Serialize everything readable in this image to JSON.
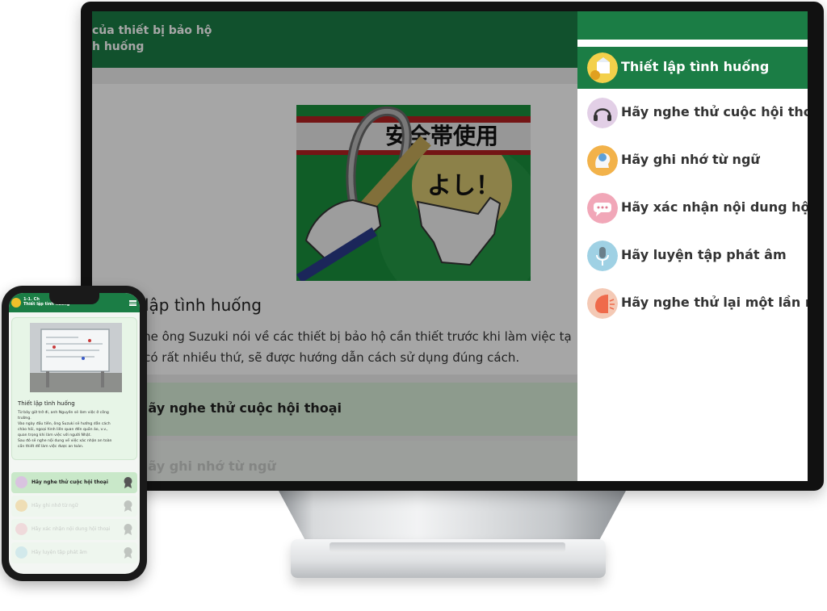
{
  "monitor": {
    "page": {
      "header_line1": "của thiết bị bảo hộ",
      "header_line2": "h huống",
      "scenario_title": "Thiết lập tình huống",
      "scenario_line1": "n sẽ nghe ông Suzuki nói về các thiết bị bảo hộ cần thiết trước khi làm việc tạ",
      "scenario_line2": "bảo hộ có rất nhiều thứ, sẽ được hướng dẫn cách sử dụng đúng cách.",
      "step1_label": "Hãy nghe thử cuộc hội thoại",
      "step2_label": "Hãy ghi nhớ từ ngữ",
      "hero_sign_top": "安全帯使用",
      "hero_sign_bottom": "よし！"
    },
    "menu": {
      "items": [
        {
          "label": "Thiết lập tình huống",
          "icon": "scenario-icon",
          "active": true
        },
        {
          "label": "Hãy nghe thử cuộc hội thoại",
          "icon": "headphones-icon"
        },
        {
          "label": "Hãy ghi nhớ từ ngữ",
          "icon": "memory-icon"
        },
        {
          "label": "Hãy xác nhận nội dung hội th",
          "icon": "chat-bubble-icon"
        },
        {
          "label": "Hãy luyện tập phát âm",
          "icon": "microphone-icon"
        },
        {
          "label": "Hãy nghe thử lại một lần nữa",
          "icon": "listen-again-icon"
        }
      ]
    }
  },
  "phone": {
    "header_line1": "1-1. Ch",
    "header_line2": "Thiết lập tình huống",
    "card_title": "Thiết lập tình huống",
    "card_lines": [
      "Từ bây giờ trở đi, anh Nguyên sẽ làm việc ở công",
      "trường.",
      "Vào ngày đầu tiên, ông Suzuki sẽ hướng dẫn cách",
      "chào hỏi, ngoại hình liên quan đến quần áo, v.v.,",
      " quan trọng khi làm việc với người Nhật.",
      "Sau đó sẽ nghe nội dung về việc xác nhận an toàn",
      "cần thiết để làm việc được an toàn."
    ],
    "items": [
      {
        "label": "Hãy nghe thử cuộc hội thoại"
      },
      {
        "label": "Hãy ghi nhớ từ ngữ"
      },
      {
        "label": "Hãy xác nhận nội dung hội thoại"
      },
      {
        "label": "Hãy luyện tập phát âm"
      }
    ]
  },
  "colors": {
    "brand_green": "#1b7d45",
    "light_green": "#d9efd9"
  }
}
